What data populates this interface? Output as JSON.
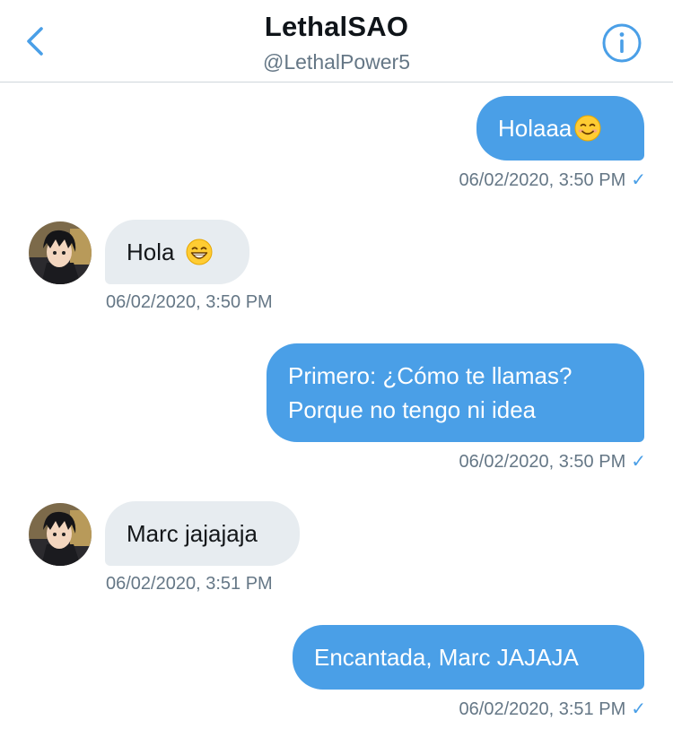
{
  "header": {
    "title": "LethalSAO",
    "handle": "@LethalPower5",
    "back_icon": "chevron-left-icon",
    "info_icon": "info-icon"
  },
  "colors": {
    "accent": "#4a9fe7",
    "received_bubble": "#e7ecf0",
    "timestamp": "#657786"
  },
  "messages": [
    {
      "direction": "sent",
      "text": "Holaaa",
      "emoji": "smiling-face-icon",
      "timestamp": "06/02/2020, 3:50 PM",
      "seen": "✓"
    },
    {
      "direction": "received",
      "text": "Hola",
      "emoji": "grinning-face-icon",
      "timestamp": "06/02/2020, 3:50 PM"
    },
    {
      "direction": "sent",
      "lines": [
        "Primero: ¿Cómo te llamas?",
        "Porque no tengo ni idea"
      ],
      "timestamp": "06/02/2020, 3:50 PM",
      "seen": "✓"
    },
    {
      "direction": "received",
      "text": "Marc jajajaja",
      "timestamp": "06/02/2020, 3:51 PM"
    },
    {
      "direction": "sent",
      "text": "Encantada, Marc JAJAJA",
      "timestamp": "06/02/2020, 3:51 PM",
      "seen": "✓"
    }
  ]
}
